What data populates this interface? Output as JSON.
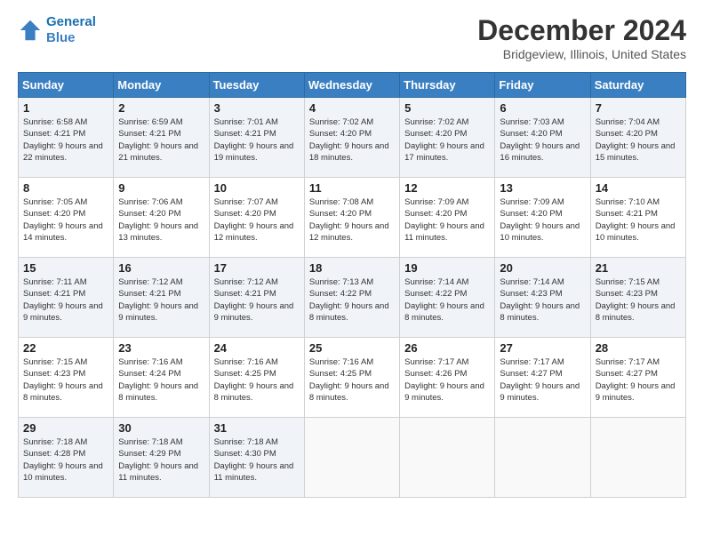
{
  "logo": {
    "line1": "General",
    "line2": "Blue"
  },
  "title": "December 2024",
  "subtitle": "Bridgeview, Illinois, United States",
  "days_of_week": [
    "Sunday",
    "Monday",
    "Tuesday",
    "Wednesday",
    "Thursday",
    "Friday",
    "Saturday"
  ],
  "weeks": [
    [
      {
        "day": "1",
        "sunrise": "Sunrise: 6:58 AM",
        "sunset": "Sunset: 4:21 PM",
        "daylight": "Daylight: 9 hours and 22 minutes."
      },
      {
        "day": "2",
        "sunrise": "Sunrise: 6:59 AM",
        "sunset": "Sunset: 4:21 PM",
        "daylight": "Daylight: 9 hours and 21 minutes."
      },
      {
        "day": "3",
        "sunrise": "Sunrise: 7:01 AM",
        "sunset": "Sunset: 4:21 PM",
        "daylight": "Daylight: 9 hours and 19 minutes."
      },
      {
        "day": "4",
        "sunrise": "Sunrise: 7:02 AM",
        "sunset": "Sunset: 4:20 PM",
        "daylight": "Daylight: 9 hours and 18 minutes."
      },
      {
        "day": "5",
        "sunrise": "Sunrise: 7:02 AM",
        "sunset": "Sunset: 4:20 PM",
        "daylight": "Daylight: 9 hours and 17 minutes."
      },
      {
        "day": "6",
        "sunrise": "Sunrise: 7:03 AM",
        "sunset": "Sunset: 4:20 PM",
        "daylight": "Daylight: 9 hours and 16 minutes."
      },
      {
        "day": "7",
        "sunrise": "Sunrise: 7:04 AM",
        "sunset": "Sunset: 4:20 PM",
        "daylight": "Daylight: 9 hours and 15 minutes."
      }
    ],
    [
      {
        "day": "8",
        "sunrise": "Sunrise: 7:05 AM",
        "sunset": "Sunset: 4:20 PM",
        "daylight": "Daylight: 9 hours and 14 minutes."
      },
      {
        "day": "9",
        "sunrise": "Sunrise: 7:06 AM",
        "sunset": "Sunset: 4:20 PM",
        "daylight": "Daylight: 9 hours and 13 minutes."
      },
      {
        "day": "10",
        "sunrise": "Sunrise: 7:07 AM",
        "sunset": "Sunset: 4:20 PM",
        "daylight": "Daylight: 9 hours and 12 minutes."
      },
      {
        "day": "11",
        "sunrise": "Sunrise: 7:08 AM",
        "sunset": "Sunset: 4:20 PM",
        "daylight": "Daylight: 9 hours and 12 minutes."
      },
      {
        "day": "12",
        "sunrise": "Sunrise: 7:09 AM",
        "sunset": "Sunset: 4:20 PM",
        "daylight": "Daylight: 9 hours and 11 minutes."
      },
      {
        "day": "13",
        "sunrise": "Sunrise: 7:09 AM",
        "sunset": "Sunset: 4:20 PM",
        "daylight": "Daylight: 9 hours and 10 minutes."
      },
      {
        "day": "14",
        "sunrise": "Sunrise: 7:10 AM",
        "sunset": "Sunset: 4:21 PM",
        "daylight": "Daylight: 9 hours and 10 minutes."
      }
    ],
    [
      {
        "day": "15",
        "sunrise": "Sunrise: 7:11 AM",
        "sunset": "Sunset: 4:21 PM",
        "daylight": "Daylight: 9 hours and 9 minutes."
      },
      {
        "day": "16",
        "sunrise": "Sunrise: 7:12 AM",
        "sunset": "Sunset: 4:21 PM",
        "daylight": "Daylight: 9 hours and 9 minutes."
      },
      {
        "day": "17",
        "sunrise": "Sunrise: 7:12 AM",
        "sunset": "Sunset: 4:21 PM",
        "daylight": "Daylight: 9 hours and 9 minutes."
      },
      {
        "day": "18",
        "sunrise": "Sunrise: 7:13 AM",
        "sunset": "Sunset: 4:22 PM",
        "daylight": "Daylight: 9 hours and 8 minutes."
      },
      {
        "day": "19",
        "sunrise": "Sunrise: 7:14 AM",
        "sunset": "Sunset: 4:22 PM",
        "daylight": "Daylight: 9 hours and 8 minutes."
      },
      {
        "day": "20",
        "sunrise": "Sunrise: 7:14 AM",
        "sunset": "Sunset: 4:23 PM",
        "daylight": "Daylight: 9 hours and 8 minutes."
      },
      {
        "day": "21",
        "sunrise": "Sunrise: 7:15 AM",
        "sunset": "Sunset: 4:23 PM",
        "daylight": "Daylight: 9 hours and 8 minutes."
      }
    ],
    [
      {
        "day": "22",
        "sunrise": "Sunrise: 7:15 AM",
        "sunset": "Sunset: 4:23 PM",
        "daylight": "Daylight: 9 hours and 8 minutes."
      },
      {
        "day": "23",
        "sunrise": "Sunrise: 7:16 AM",
        "sunset": "Sunset: 4:24 PM",
        "daylight": "Daylight: 9 hours and 8 minutes."
      },
      {
        "day": "24",
        "sunrise": "Sunrise: 7:16 AM",
        "sunset": "Sunset: 4:25 PM",
        "daylight": "Daylight: 9 hours and 8 minutes."
      },
      {
        "day": "25",
        "sunrise": "Sunrise: 7:16 AM",
        "sunset": "Sunset: 4:25 PM",
        "daylight": "Daylight: 9 hours and 8 minutes."
      },
      {
        "day": "26",
        "sunrise": "Sunrise: 7:17 AM",
        "sunset": "Sunset: 4:26 PM",
        "daylight": "Daylight: 9 hours and 9 minutes."
      },
      {
        "day": "27",
        "sunrise": "Sunrise: 7:17 AM",
        "sunset": "Sunset: 4:27 PM",
        "daylight": "Daylight: 9 hours and 9 minutes."
      },
      {
        "day": "28",
        "sunrise": "Sunrise: 7:17 AM",
        "sunset": "Sunset: 4:27 PM",
        "daylight": "Daylight: 9 hours and 9 minutes."
      }
    ],
    [
      {
        "day": "29",
        "sunrise": "Sunrise: 7:18 AM",
        "sunset": "Sunset: 4:28 PM",
        "daylight": "Daylight: 9 hours and 10 minutes."
      },
      {
        "day": "30",
        "sunrise": "Sunrise: 7:18 AM",
        "sunset": "Sunset: 4:29 PM",
        "daylight": "Daylight: 9 hours and 11 minutes."
      },
      {
        "day": "31",
        "sunrise": "Sunrise: 7:18 AM",
        "sunset": "Sunset: 4:30 PM",
        "daylight": "Daylight: 9 hours and 11 minutes."
      },
      null,
      null,
      null,
      null
    ]
  ]
}
